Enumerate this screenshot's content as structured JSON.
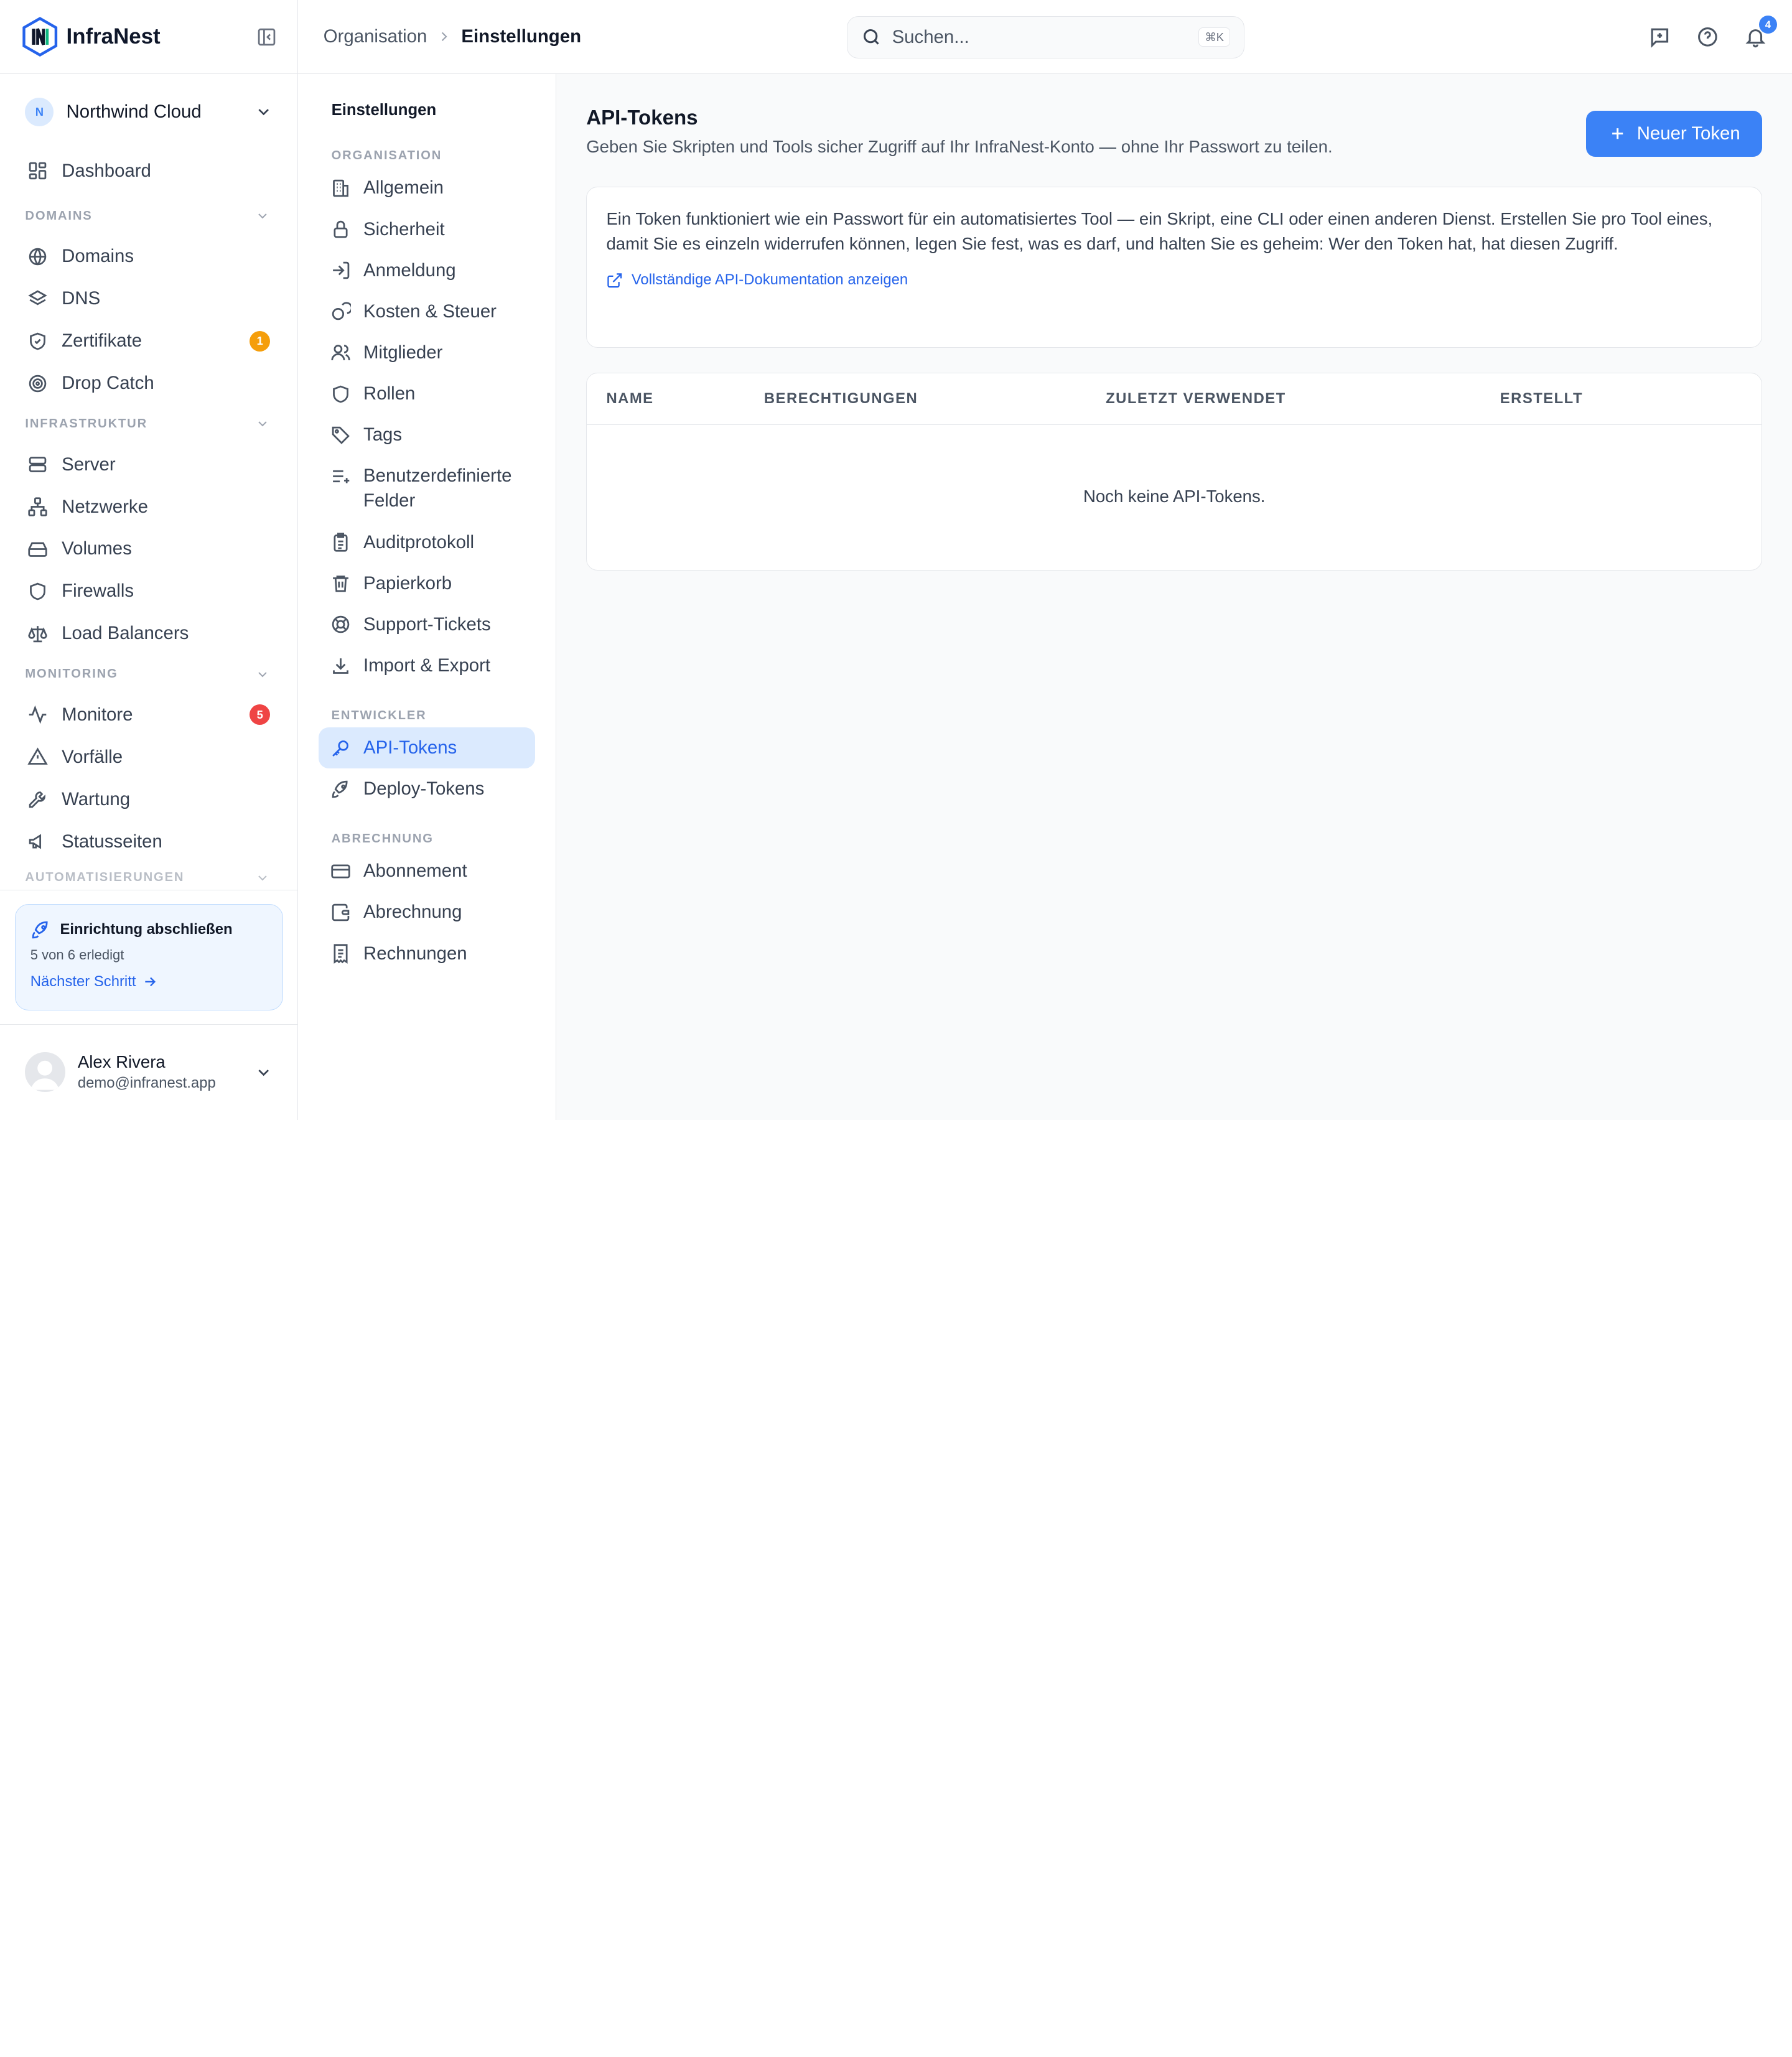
{
  "app": {
    "name": "InfraNest"
  },
  "org": {
    "initial": "N",
    "name": "Northwind Cloud"
  },
  "sidebar": {
    "dashboard": "Dashboard",
    "sections": [
      {
        "header": "DOMAINS",
        "items": [
          {
            "label": "Domains",
            "icon": "globe-icon"
          },
          {
            "label": "DNS",
            "icon": "layers-icon"
          },
          {
            "label": "Zertifikate",
            "icon": "shield-check-icon",
            "badge": "1",
            "badge_color": "#f59e0b"
          },
          {
            "label": "Drop Catch",
            "icon": "target-icon"
          }
        ]
      },
      {
        "header": "INFRASTRUKTUR",
        "items": [
          {
            "label": "Server",
            "icon": "server-icon"
          },
          {
            "label": "Netzwerke",
            "icon": "network-icon"
          },
          {
            "label": "Volumes",
            "icon": "hard-drive-icon"
          },
          {
            "label": "Firewalls",
            "icon": "shield-icon"
          },
          {
            "label": "Load Balancers",
            "icon": "scale-icon"
          }
        ]
      },
      {
        "header": "MONITORING",
        "items": [
          {
            "label": "Monitore",
            "icon": "activity-icon",
            "badge": "5",
            "badge_color": "#ef4444"
          },
          {
            "label": "Vorfälle",
            "icon": "alert-triangle-icon"
          },
          {
            "label": "Wartung",
            "icon": "wrench-icon"
          },
          {
            "label": "Statusseiten",
            "icon": "megaphone-icon"
          }
        ]
      },
      {
        "header": "AUTOMATISIERUNGEN",
        "items": []
      }
    ],
    "setup": {
      "title": "Einrichtung abschließen",
      "progress": "5 von 6 erledigt",
      "link": "Nächster Schritt"
    },
    "user": {
      "name": "Alex Rivera",
      "email": "demo@infranest.app"
    }
  },
  "topbar": {
    "breadcrumb": [
      "Organisation",
      "Einstellungen"
    ],
    "search_placeholder": "Suchen...",
    "search_shortcut": "⌘K",
    "notification_count": "4"
  },
  "subnav": {
    "title": "Einstellungen",
    "groups": [
      {
        "header": "ORGANISATION",
        "items": [
          "Allgemein",
          "Sicherheit",
          "Anmeldung",
          "Kosten & Steuer",
          "Mitglieder",
          "Rollen",
          "Tags",
          "Benutzerdefinierte Felder",
          "Auditprotokoll",
          "Papierkorb",
          "Support-Tickets",
          "Import & Export"
        ]
      },
      {
        "header": "ENTWICKLER",
        "items": [
          "API-Tokens",
          "Deploy-Tokens"
        ]
      },
      {
        "header": "ABRECHNUNG",
        "items": [
          "Abonnement",
          "Abrechnung",
          "Rechnungen"
        ]
      }
    ],
    "active": "API-Tokens"
  },
  "main": {
    "title": "API-Tokens",
    "subtitle": "Geben Sie Skripten und Tools sicher Zugriff auf Ihr InfraNest-Konto — ohne Ihr Passwort zu teilen.",
    "new_button": "Neuer Token",
    "info_text": "Ein Token funktioniert wie ein Passwort für ein automatisiertes Tool — ein Skript, eine CLI oder einen anderen Dienst. Erstellen Sie pro Tool eines, damit Sie es einzeln widerrufen können, legen Sie fest, was es darf, und halten Sie es geheim: Wer den Token hat, hat diesen Zugriff.",
    "doc_link": "Vollständige API-Dokumentation anzeigen",
    "table": {
      "columns": [
        "NAME",
        "BERECHTIGUNGEN",
        "ZULETZT VERWENDET",
        "ERSTELLT"
      ],
      "empty": "Noch keine API-Tokens."
    }
  },
  "colors": {
    "accent": "#3b82f6",
    "active_bg": "#dbeafe"
  }
}
